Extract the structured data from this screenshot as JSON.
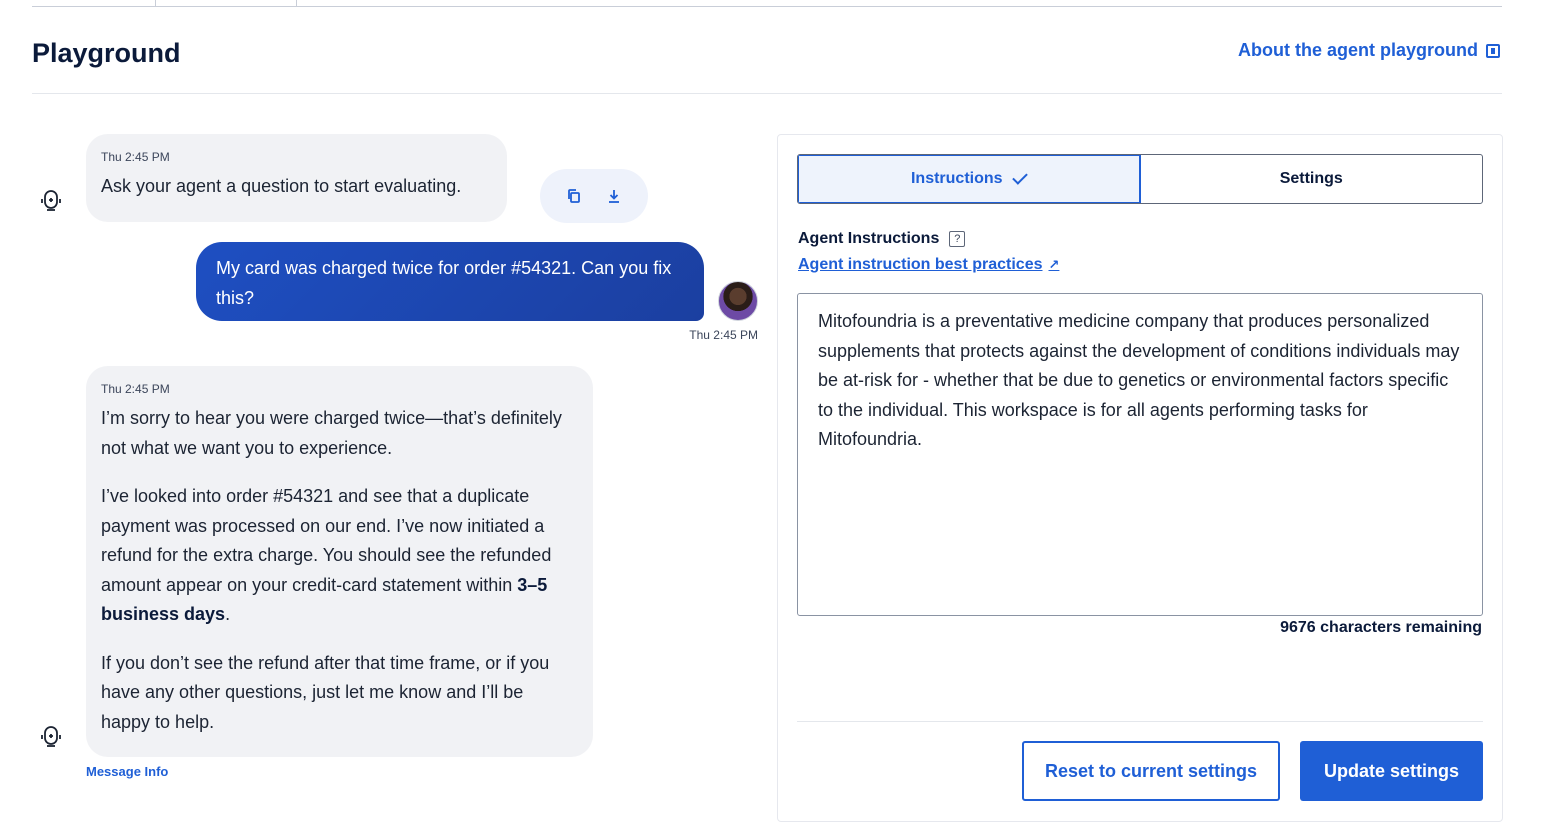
{
  "header": {
    "title": "Playground",
    "about_link": "About the agent playground"
  },
  "chat": {
    "messages": [
      {
        "role": "agent",
        "time": "Thu 2:45 PM",
        "text": "Ask your agent a question to start evaluating."
      },
      {
        "role": "user",
        "time": "Thu 2:45 PM",
        "text": "My card was charged twice for order #54321. Can you fix this?"
      },
      {
        "role": "agent",
        "time": "Thu 2:45 PM",
        "p1": "I’m sorry to hear you were charged twice—that’s definitely not what we want you to experience.",
        "p2_pre": "I’ve looked into order #54321 and see that a duplicate payment was processed on our end. I’ve now initiated a refund for the extra charge. You should see the refunded amount appear on your credit-card statement within ",
        "p2_bold": "3–5 business days",
        "p2_post": ".",
        "p3": "If you don’t see the refund after that time frame, or if you have any other questions, just let me know and I’ll be happy to help."
      }
    ],
    "message_info": "Message Info",
    "actions": [
      "copy-icon",
      "download-icon"
    ]
  },
  "panel": {
    "tabs": [
      {
        "label": "Instructions",
        "active": true
      },
      {
        "label": "Settings",
        "active": false
      }
    ],
    "agent_instructions_label": "Agent Instructions",
    "help_glyph": "?",
    "best_practices_link": "Agent instruction best practices",
    "best_practices_arrow": "↗",
    "instructions_text": "Mitofoundria is a preventative medicine company that produces personalized supplements that protects against the development of conditions individuals may be at-risk for - whether that be due to genetics or environmental factors specific to the individual. This workspace is for all agents performing tasks for Mitofoundria.",
    "characters_remaining": "9676 characters remaining",
    "reset_button": "Reset to current settings",
    "update_button": "Update settings"
  },
  "colors": {
    "accent": "#1f5fd6",
    "user_bubble": "#1e4fc2",
    "bot_bubble": "#f1f2f5",
    "title": "#0b1a3a"
  }
}
